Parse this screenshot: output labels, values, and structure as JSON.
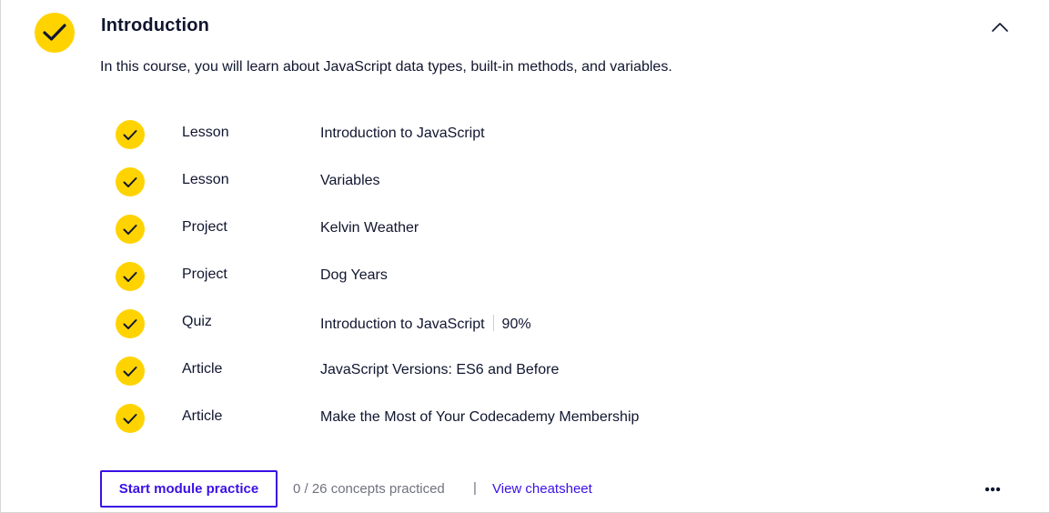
{
  "module": {
    "title": "Introduction",
    "description": "In this course, you will learn about JavaScript data types, built-in methods, and variables.",
    "collapse_icon": "chevron-up-icon",
    "completed_icon": "check-icon"
  },
  "items": [
    {
      "type": "Lesson",
      "title": "Introduction to JavaScript"
    },
    {
      "type": "Lesson",
      "title": "Variables"
    },
    {
      "type": "Project",
      "title": "Kelvin Weather"
    },
    {
      "type": "Project",
      "title": "Dog Years"
    },
    {
      "type": "Quiz",
      "title": "Introduction to JavaScript",
      "score": "90%"
    },
    {
      "type": "Article",
      "title": "JavaScript Versions: ES6 and Before"
    },
    {
      "type": "Article",
      "title": "Make the Most of Your Codecademy Membership"
    }
  ],
  "footer": {
    "practice_label": "Start module practice",
    "concepts_text": "0 / 26 concepts practiced",
    "separator": "|",
    "cheatsheet_label": "View cheatsheet",
    "more_icon": "more-horizontal-icon"
  },
  "colors": {
    "accent": "#3a10e5",
    "check_fill": "#ffd300",
    "text": "#10162f",
    "muted": "#707280"
  }
}
